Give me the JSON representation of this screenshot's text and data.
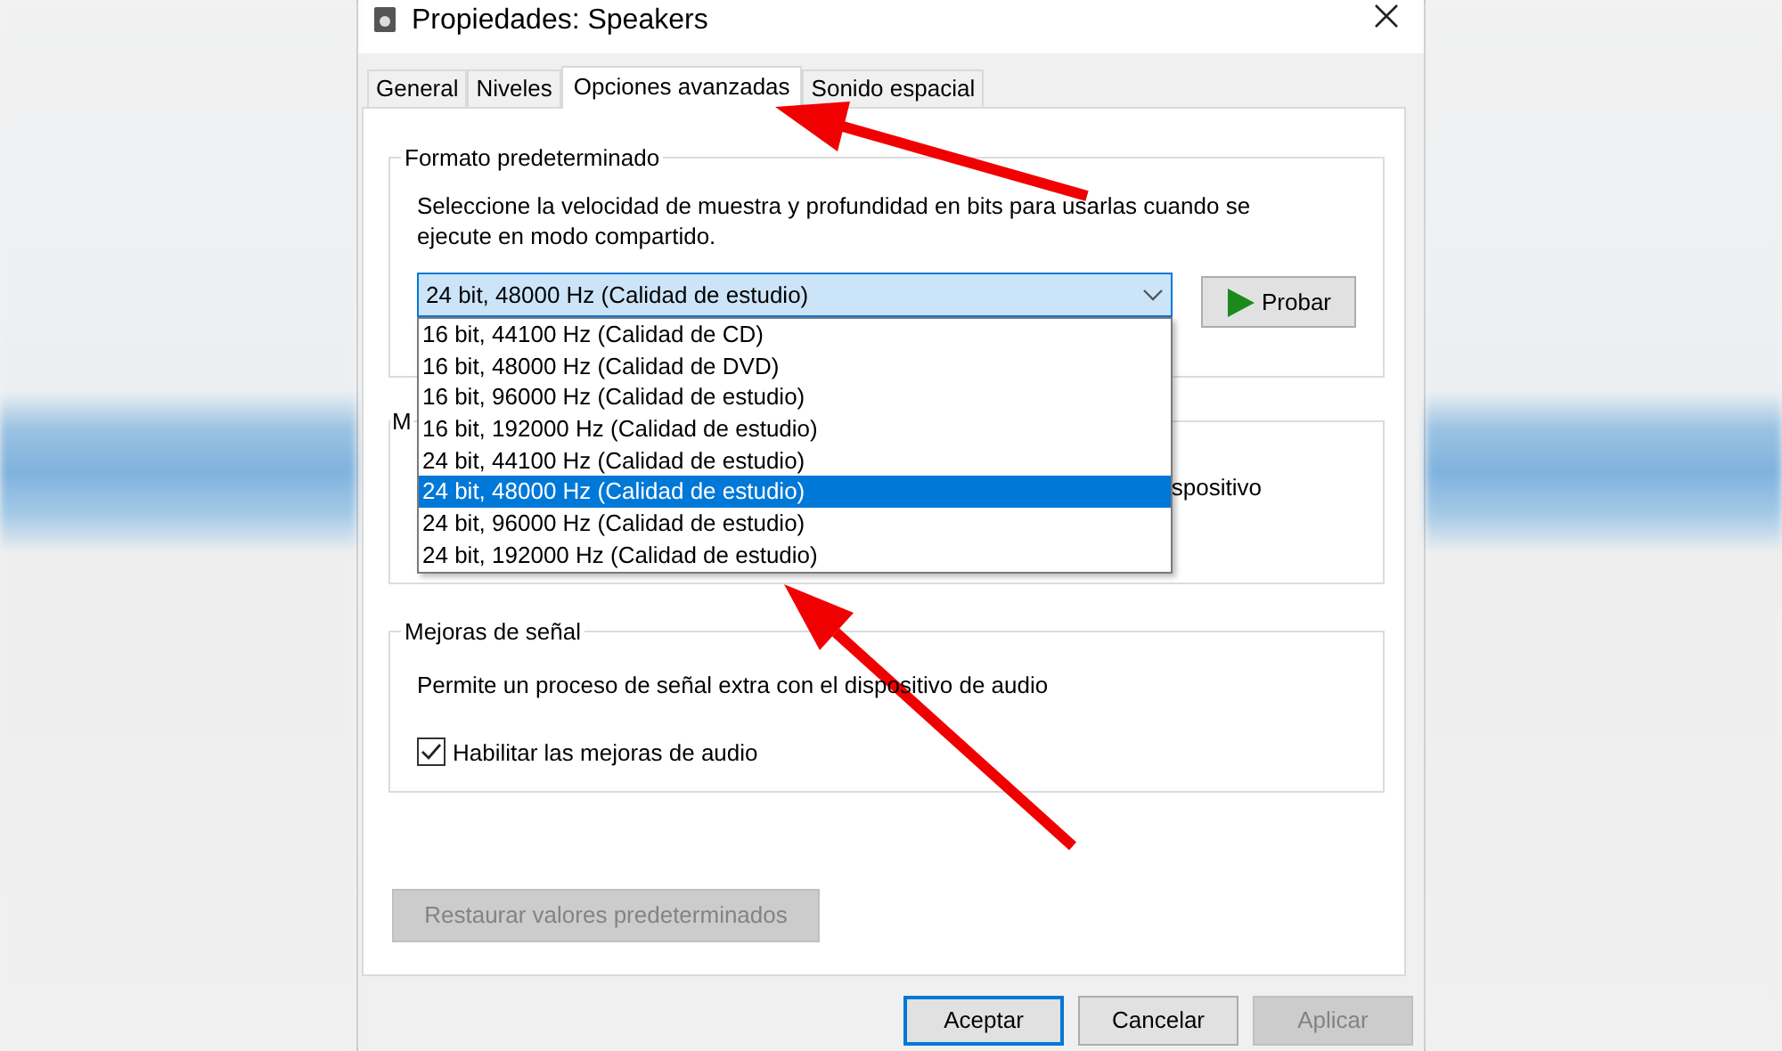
{
  "window": {
    "title": "Propiedades: Speakers"
  },
  "tabs": [
    {
      "label": "General",
      "selected": false
    },
    {
      "label": "Niveles",
      "selected": false
    },
    {
      "label": "Opciones avanzadas",
      "selected": true
    },
    {
      "label": "Sonido espacial",
      "selected": false
    }
  ],
  "format_group": {
    "legend": "Formato predeterminado",
    "description": "Seleccione la velocidad de muestra y profundidad en bits para usarlas cuando se ejecute en modo compartido.",
    "combo": {
      "value": "24 bit, 48000 Hz (Calidad de estudio)",
      "expanded": true,
      "options": [
        {
          "label": "16 bit, 44100 Hz (Calidad de CD)",
          "selected": false
        },
        {
          "label": "16 bit, 48000 Hz (Calidad de DVD)",
          "selected": false
        },
        {
          "label": "16 bit, 96000 Hz (Calidad de estudio)",
          "selected": false
        },
        {
          "label": "16 bit, 192000 Hz (Calidad de estudio)",
          "selected": false
        },
        {
          "label": "24 bit, 44100 Hz (Calidad de estudio)",
          "selected": false
        },
        {
          "label": "24 bit, 48000 Hz (Calidad de estudio)",
          "selected": true
        },
        {
          "label": "24 bit, 96000 Hz (Calidad de estudio)",
          "selected": false
        },
        {
          "label": "24 bit, 192000 Hz (Calidad de estudio)",
          "selected": false
        }
      ]
    },
    "test_button": "Probar"
  },
  "group_2": {
    "legend": "M",
    "text": "spositivo"
  },
  "enhancements_group": {
    "legend": "Mejoras de señal",
    "description": "Permite un proceso de señal extra con el dispositivo de audio",
    "checkbox": {
      "label": "Habilitar las mejoras de audio",
      "checked": true
    }
  },
  "restore_button": {
    "label": "Restaurar valores predeterminados",
    "disabled": true
  },
  "buttons": [
    {
      "label": "Aceptar",
      "disabled": false,
      "focused": true
    },
    {
      "label": "Cancelar",
      "disabled": false,
      "focused": false
    },
    {
      "label": "Aplicar",
      "disabled": true,
      "focused": false
    }
  ]
}
